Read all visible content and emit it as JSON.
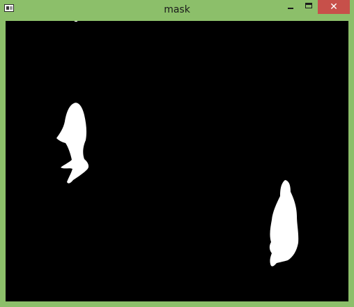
{
  "window": {
    "title": "mask",
    "frame_color": "#8cbf6a",
    "close_color": "#c7504a",
    "close_glyph": "✕"
  },
  "titlebar": {
    "icon": "opencv-window-icon",
    "buttons": [
      "minimize-icon",
      "maximize-icon",
      "close-icon"
    ]
  },
  "image": {
    "background_color": "#000000",
    "blob_color": "#ffffff"
  }
}
